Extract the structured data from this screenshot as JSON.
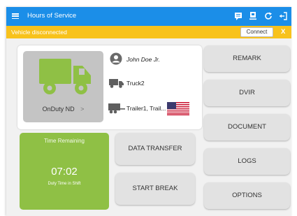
{
  "header": {
    "title": "Hours of Service",
    "icons": [
      "menu-icon",
      "chat-icon",
      "download-icon",
      "refresh-icon",
      "logout-icon"
    ]
  },
  "banner": {
    "message": "Vehicle disconnected",
    "connect_label": "Connect",
    "close_label": "X"
  },
  "driver_card": {
    "duty_status": "OnDuty ND",
    "duty_chevron": ">",
    "driver_name": "John Doe Jr.",
    "vehicle": "Truck2",
    "trailers": "Trailer1, Trail..."
  },
  "time_remaining": {
    "title": "Time Remaining",
    "value": "07:02",
    "subtitle": "Duty Time in Shift"
  },
  "buttons": {
    "data_transfer": "DATA TRANSFER",
    "start_break": "START BREAK",
    "remark": "REMARK",
    "dvir": "DVIR",
    "document": "DOCUMENT",
    "logs": "LOGS",
    "options": "OPTIONS"
  },
  "colors": {
    "header": "#1b8ee8",
    "banner": "#f8c21c",
    "truck": "#8fc045",
    "time_tile": "#8fc045",
    "button": "#e2e2e2"
  }
}
